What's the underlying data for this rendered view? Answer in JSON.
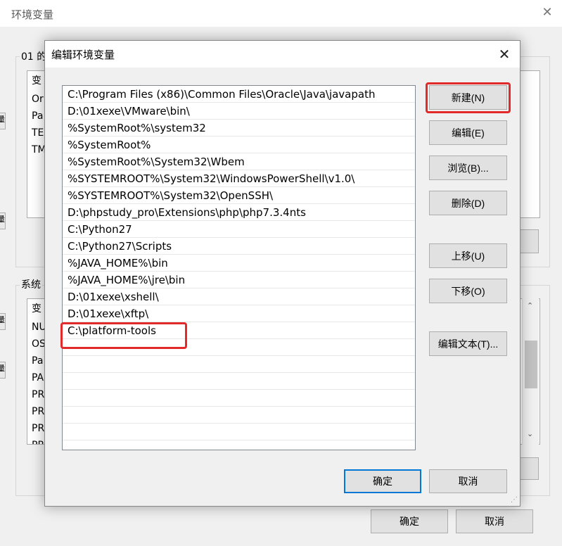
{
  "outer_window": {
    "title": "环境变量",
    "user_group_label": "01 的",
    "user_list_rows": [
      "变",
      "Or",
      "Pa",
      "TE",
      "TM"
    ],
    "system_group_label": "系统",
    "system_list_rows": [
      "变",
      "NU",
      "OS",
      "Pa",
      "PA",
      "PR",
      "PR",
      "PR",
      "PR"
    ],
    "ok_label": "确定",
    "cancel_label": "取消",
    "edge_fragment": "量"
  },
  "dialog": {
    "title": "编辑环境变量",
    "paths": [
      "C:\\Program Files (x86)\\Common Files\\Oracle\\Java\\javapath",
      "D:\\01xexe\\VMware\\bin\\",
      "%SystemRoot%\\system32",
      "%SystemRoot%",
      "%SystemRoot%\\System32\\Wbem",
      "%SYSTEMROOT%\\System32\\WindowsPowerShell\\v1.0\\",
      "%SYSTEMROOT%\\System32\\OpenSSH\\",
      "D:\\phpstudy_pro\\Extensions\\php\\php7.3.4nts",
      "C:\\Python27",
      "C:\\Python27\\Scripts",
      "%JAVA_HOME%\\bin",
      "%JAVA_HOME%\\jre\\bin",
      "D:\\01xexe\\xshell\\",
      "D:\\01xexe\\xftp\\",
      "C:\\platform-tools"
    ],
    "buttons": {
      "new": "新建(N)",
      "edit": "编辑(E)",
      "browse": "浏览(B)...",
      "delete": "删除(D)",
      "move_up": "上移(U)",
      "move_down": "下移(O)",
      "edit_text": "编辑文本(T)..."
    },
    "ok_label": "确定",
    "cancel_label": "取消"
  },
  "colors": {
    "highlight": "#e22a2a",
    "default_button_border": "#0078d7"
  }
}
